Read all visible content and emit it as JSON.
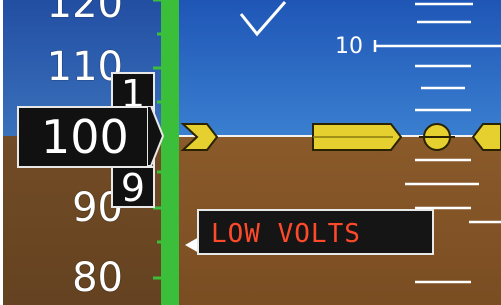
{
  "airspeed": {
    "tape_labels": [
      "120",
      "110",
      "90",
      "80"
    ],
    "current": {
      "main": "100",
      "upper_digit": "1",
      "lower_digit": "9"
    }
  },
  "attitude": {
    "pitch_label": "10"
  },
  "annunciation": {
    "text": "LOW VOLTS",
    "color": "#ff4a2a"
  },
  "colors": {
    "sky": "#2f6ec8",
    "ground": "#7f5025",
    "airspeed_band": "#3bbf3b",
    "aircraft_symbol": "#e6d030"
  }
}
